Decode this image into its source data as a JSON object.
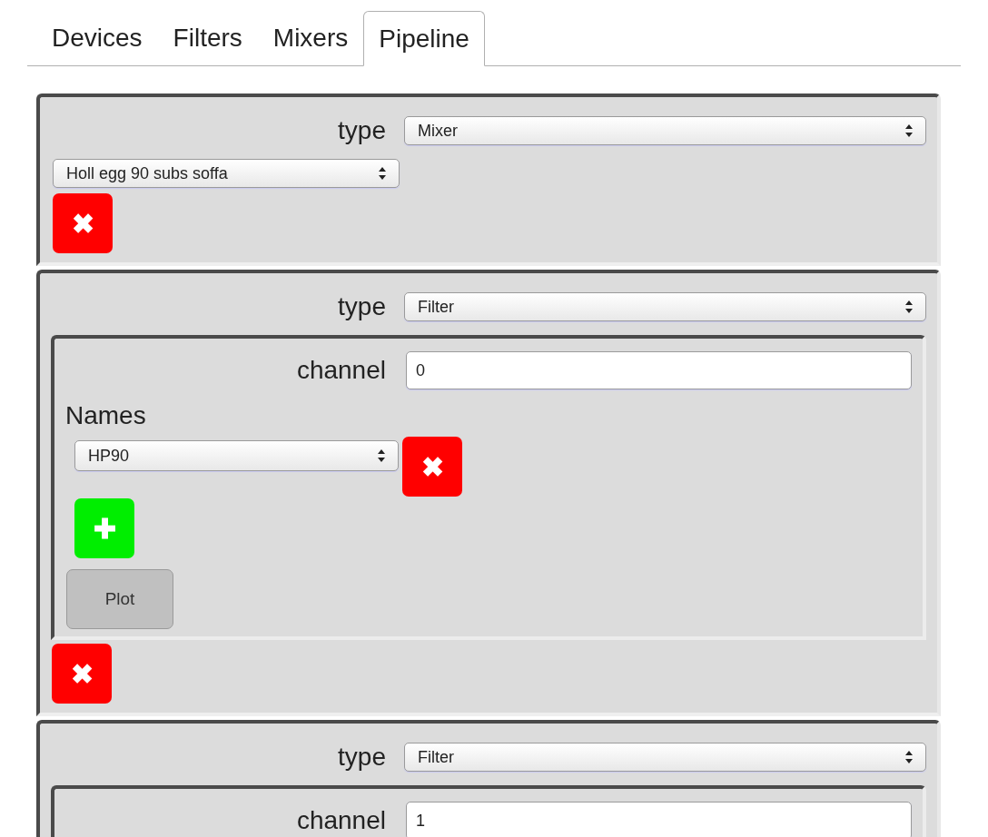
{
  "tabs": [
    {
      "label": "Devices",
      "selected": false
    },
    {
      "label": "Filters",
      "selected": false
    },
    {
      "label": "Mixers",
      "selected": false
    },
    {
      "label": "Pipeline",
      "selected": true
    }
  ],
  "steps": [
    {
      "kind": "mixer",
      "type_label": "type",
      "type_value": "Mixer",
      "name_value": "Holl egg 90 subs soffa",
      "delete_icon": "✖"
    },
    {
      "kind": "filter",
      "type_label": "type",
      "type_value": "Filter",
      "channel_label": "channel",
      "channel_value": "0",
      "names_label": "Names",
      "names": [
        {
          "value": "HP90",
          "delete_icon": "✖"
        }
      ],
      "add_icon": "✚",
      "plot_label": "Plot",
      "delete_icon": "✖"
    },
    {
      "kind": "filter",
      "type_label": "type",
      "type_value": "Filter",
      "channel_label": "channel",
      "channel_value": "1"
    }
  ]
}
